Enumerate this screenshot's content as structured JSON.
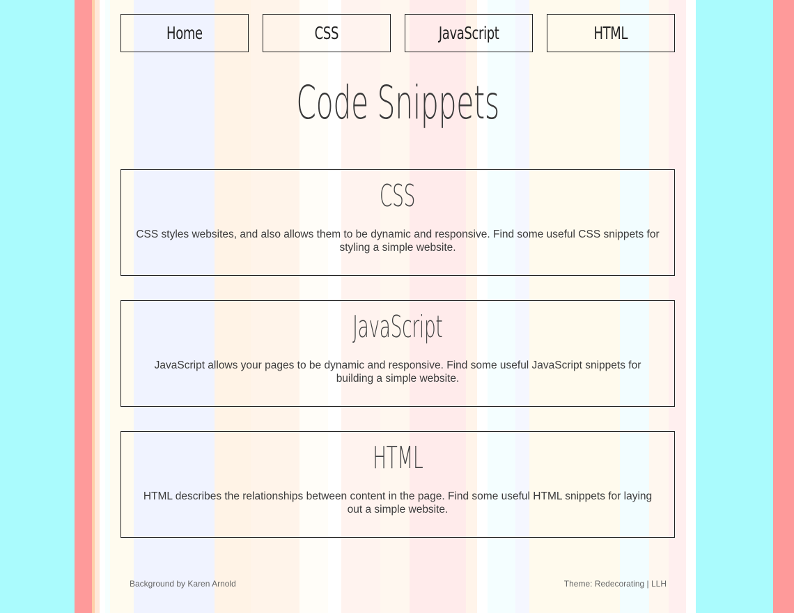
{
  "nav": {
    "items": [
      {
        "label": "Home"
      },
      {
        "label": "CSS"
      },
      {
        "label": "JavaScript"
      },
      {
        "label": "HTML"
      }
    ]
  },
  "page": {
    "title": "Code Snippets"
  },
  "cards": [
    {
      "title": "CSS",
      "text": "CSS styles websites, and also allows them to be dynamic and responsive. Find some useful CSS snippets for styling a simple website."
    },
    {
      "title": "JavaScript",
      "text": "JavaScript allows your pages to be dynamic and responsive. Find some useful JavaScript snippets for building a simple website."
    },
    {
      "title": "HTML",
      "text": "HTML describes the relationships between content in the page. Find some useful HTML snippets for laying out a simple website."
    }
  ],
  "footer": {
    "background_credit": "Background by Karen Arnold",
    "theme_credit": "Theme: Redecorating | LLH"
  },
  "colors": {
    "border": "#222222",
    "text": "#3b3b3b",
    "stripe_cyan": "#aafbfd",
    "stripe_pink": "#fe9a9a"
  }
}
